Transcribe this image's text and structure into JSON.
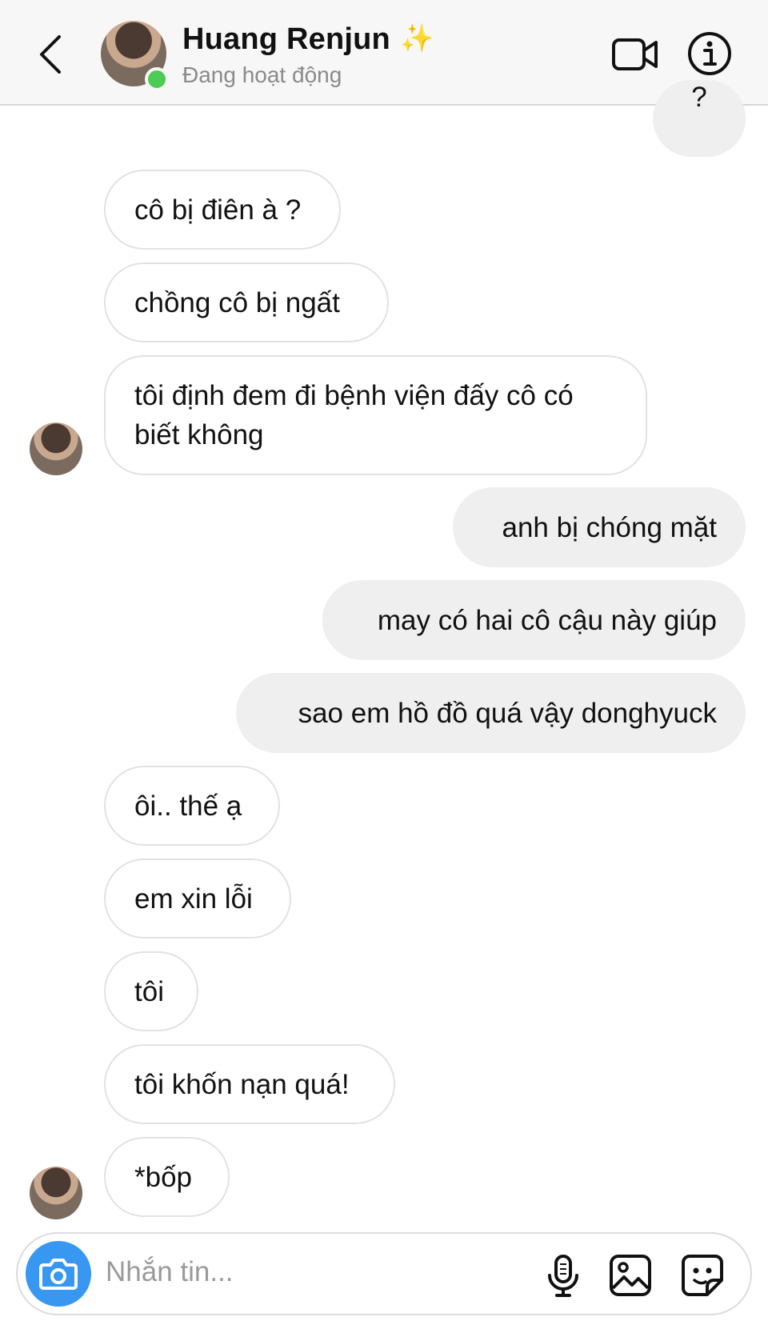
{
  "header": {
    "contact_name": "Huang Renjun",
    "sparkle": "✨",
    "status": "Đang hoạt động",
    "icons": [
      "back-icon",
      "video-call-icon",
      "info-icon"
    ]
  },
  "messages": [
    {
      "side": "sent",
      "text": "?"
    },
    {
      "side": "received",
      "text": "cô bị điên à ?"
    },
    {
      "side": "received",
      "text": "chồng cô bị ngất"
    },
    {
      "side": "received",
      "text": "tôi định đem đi bệnh viện đấy cô có biết không"
    },
    {
      "side": "sent",
      "text": "anh bị chóng mặt"
    },
    {
      "side": "sent",
      "text": "may có hai cô cậu này giúp"
    },
    {
      "side": "sent",
      "text": "sao em hồ đồ quá vậy donghyuck"
    },
    {
      "side": "received",
      "text": "ôi.. thế ạ"
    },
    {
      "side": "received",
      "text": "em xin lỗi"
    },
    {
      "side": "received",
      "text": "tôi"
    },
    {
      "side": "received",
      "text": "tôi khốn nạn quá!"
    },
    {
      "side": "received",
      "text": "*bốp"
    }
  ],
  "composer": {
    "placeholder": "Nhắn tin...",
    "icons": [
      "camera-icon",
      "microphone-icon",
      "gallery-icon",
      "sticker-icon"
    ],
    "camera_color": "#3897f0"
  },
  "colors": {
    "online": "#4ccc52",
    "sent_bubble": "#efefef",
    "received_border": "#e2e2e2"
  }
}
